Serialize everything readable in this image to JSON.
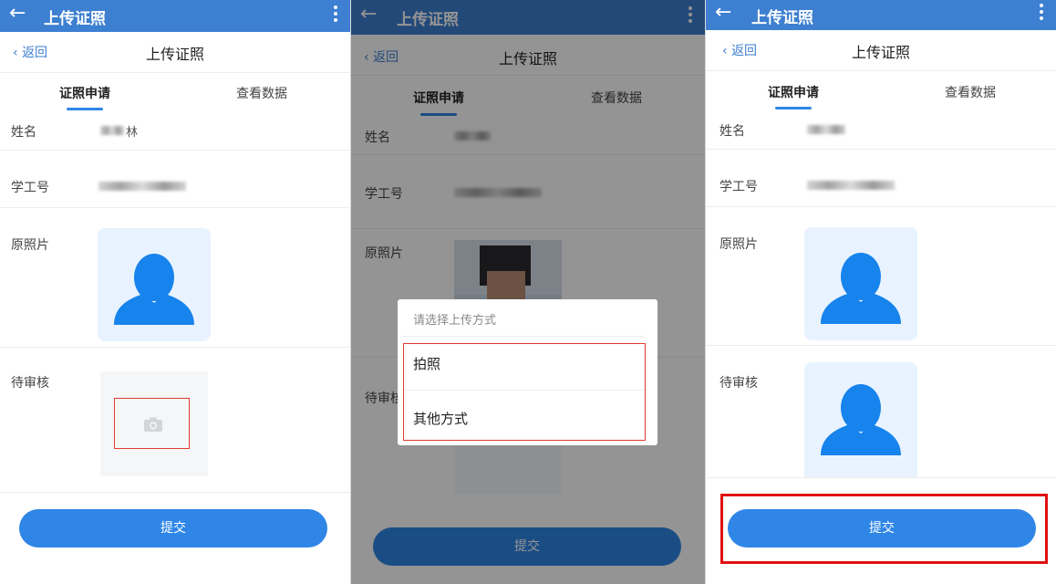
{
  "appbar": {
    "title": "上传证照",
    "back_icon": "arrow-left-icon",
    "more_icon": "more-vertical-icon"
  },
  "subheader": {
    "back_label": "返回",
    "title": "上传证照"
  },
  "tabs": [
    {
      "label": "证照申请"
    },
    {
      "label": "查看数据"
    }
  ],
  "form": {
    "name_label": "姓名",
    "name_value_visible": "林",
    "id_label": "学工号",
    "original_photo_label": "原照片",
    "pending_label": "待审核"
  },
  "dialog": {
    "title": "请选择上传方式",
    "options": [
      {
        "label": "拍照"
      },
      {
        "label": "其他方式"
      }
    ]
  },
  "submit_label": "提交",
  "colors": {
    "appbar": "#3d7fd1",
    "accent": "#2f86e6",
    "highlight": "#e01010",
    "avatar_bg": "#e8f3ff"
  }
}
